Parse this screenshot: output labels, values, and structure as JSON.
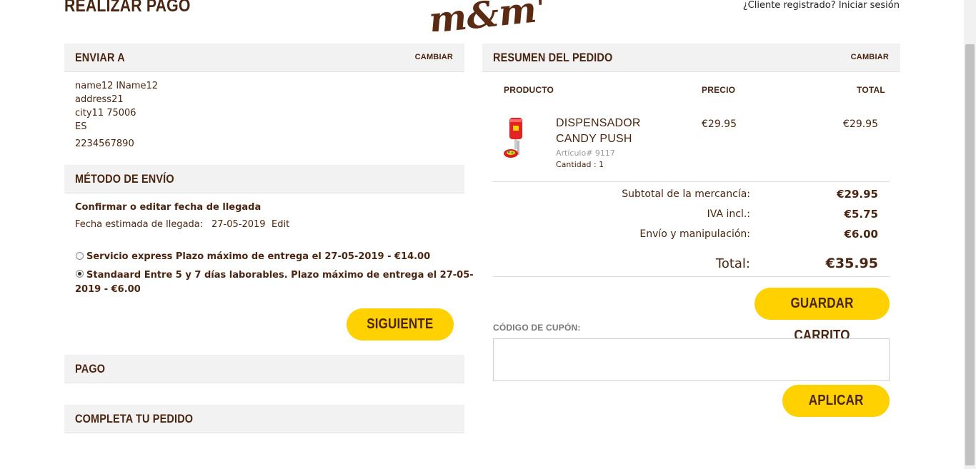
{
  "page": {
    "title": "REALIZAR PAGO",
    "login_link": "¿Cliente registrado? Iniciar sesión"
  },
  "ship_to": {
    "header": "ENVIAR A",
    "change": "CAMBIAR",
    "name": "name12 lName12",
    "address": "address21",
    "city": "city11 75006",
    "country": "ES",
    "phone": "2234567890"
  },
  "shipping_method": {
    "header": "MÉTODO DE ENVÍO",
    "confirm": "Confirmar o editar fecha de llegada",
    "estimate_label": "Fecha estimada de llegada:",
    "estimate_date": "27-05-2019",
    "edit": "Edit",
    "options": [
      {
        "label": "Servicio express Plazo máximo de entrega el 27-05-2019 - €14.00",
        "selected": false
      },
      {
        "label": "Standaard Entre 5 y 7 días laborables. Plazo máximo de entrega el 27-05-",
        "label_cont": "2019 - €6.00",
        "selected": true
      }
    ],
    "next_button": "SIGUIENTE"
  },
  "payment": {
    "header": "PAGO"
  },
  "complete": {
    "header": "COMPLETA TU PEDIDO"
  },
  "summary": {
    "header": "RESUMEN DEL PEDIDO",
    "change": "CAMBIAR",
    "columns": {
      "product": "PRODUCTO",
      "price": "PRECIO",
      "total": "TOTAL"
    },
    "item": {
      "name_line1": "DISPENSADOR",
      "name_line2": "CANDY PUSH",
      "article": "Artículo# 9117",
      "quantity": "Cantidad : 1",
      "price": "€29.95",
      "total": "€29.95"
    },
    "subtotal_label": "Subtotal de la mercancía:",
    "subtotal": "€29.95",
    "vat_label": "IVA incl.:",
    "vat": "€5.75",
    "shipping_label": "Envío y manipulación:",
    "shipping": "€6.00",
    "total_label": "Total:",
    "total": "€35.95",
    "save_cart_button": "GUARDAR CARRITO",
    "coupon_label": "CÓDIGO DE CUPÓN:",
    "coupon_value": "",
    "apply_button": "APLICAR"
  },
  "brand": {
    "logo_text": "m&m's",
    "logo_color": "#5b2a12",
    "accent": "#ffd100"
  }
}
